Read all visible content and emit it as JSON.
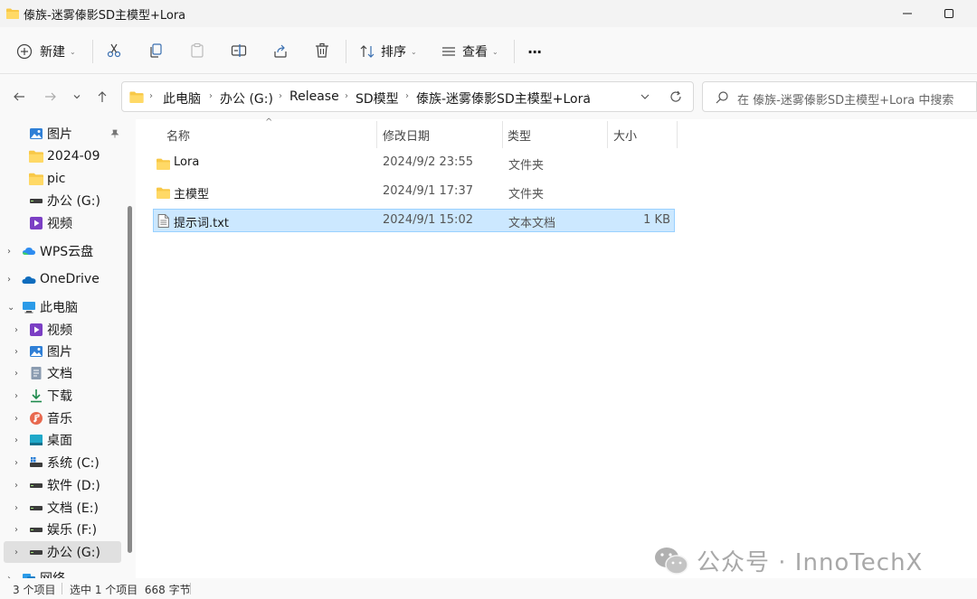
{
  "window": {
    "title": "傣族-迷雾傣影SD主模型+Lora"
  },
  "toolbar": {
    "new_label": "新建",
    "sort_label": "排序",
    "view_label": "查看",
    "more_label": "···"
  },
  "address": {
    "crumbs": [
      "此电脑",
      "办公 (G:)",
      "Release",
      "SD模型",
      "傣族-迷雾傣影SD主模型+Lora"
    ],
    "search_placeholder": "在 傣族-迷雾傣影SD主模型+Lora 中搜索"
  },
  "sidebar": {
    "items": [
      {
        "label": "图片",
        "icon": "pictures-icon"
      },
      {
        "label": "2024-09",
        "icon": "folder-icon"
      },
      {
        "label": "pic",
        "icon": "folder-icon"
      },
      {
        "label": "办公 (G:)",
        "icon": "drive-icon"
      },
      {
        "label": "视频",
        "icon": "videos-icon"
      },
      {
        "label": "WPS云盘",
        "icon": "wps-cloud-icon"
      },
      {
        "label": "OneDrive",
        "icon": "onedrive-icon"
      },
      {
        "label": "此电脑",
        "icon": "computer-icon"
      },
      {
        "label": "视频",
        "icon": "videos-icon"
      },
      {
        "label": "图片",
        "icon": "pictures-icon"
      },
      {
        "label": "文档",
        "icon": "documents-icon"
      },
      {
        "label": "下载",
        "icon": "downloads-icon"
      },
      {
        "label": "音乐",
        "icon": "music-icon"
      },
      {
        "label": "桌面",
        "icon": "desktop-icon"
      },
      {
        "label": "系统 (C:)",
        "icon": "system-drive-icon"
      },
      {
        "label": "软件 (D:)",
        "icon": "drive-icon"
      },
      {
        "label": "文档 (E:)",
        "icon": "drive-icon"
      },
      {
        "label": "娱乐 (F:)",
        "icon": "drive-icon"
      },
      {
        "label": "办公 (G:)",
        "icon": "drive-icon"
      },
      {
        "label": "网络",
        "icon": "network-icon"
      }
    ]
  },
  "columns": {
    "name": "名称",
    "modified": "修改日期",
    "type": "类型",
    "size": "大小"
  },
  "files": [
    {
      "name": "Lora",
      "modified": "2024/9/2 23:55",
      "type": "文件夹",
      "size": "",
      "icon": "folder-icon"
    },
    {
      "name": "主模型",
      "modified": "2024/9/1 17:37",
      "type": "文件夹",
      "size": "",
      "icon": "folder-icon"
    },
    {
      "name": "提示词.txt",
      "modified": "2024/9/1 15:02",
      "type": "文本文档",
      "size": "1 KB",
      "icon": "text-file-icon"
    }
  ],
  "status": {
    "count": "3 个项目",
    "selection": "选中 1 个项目  668 字节"
  },
  "watermark": {
    "text": "公众号 · InnoTechX"
  }
}
